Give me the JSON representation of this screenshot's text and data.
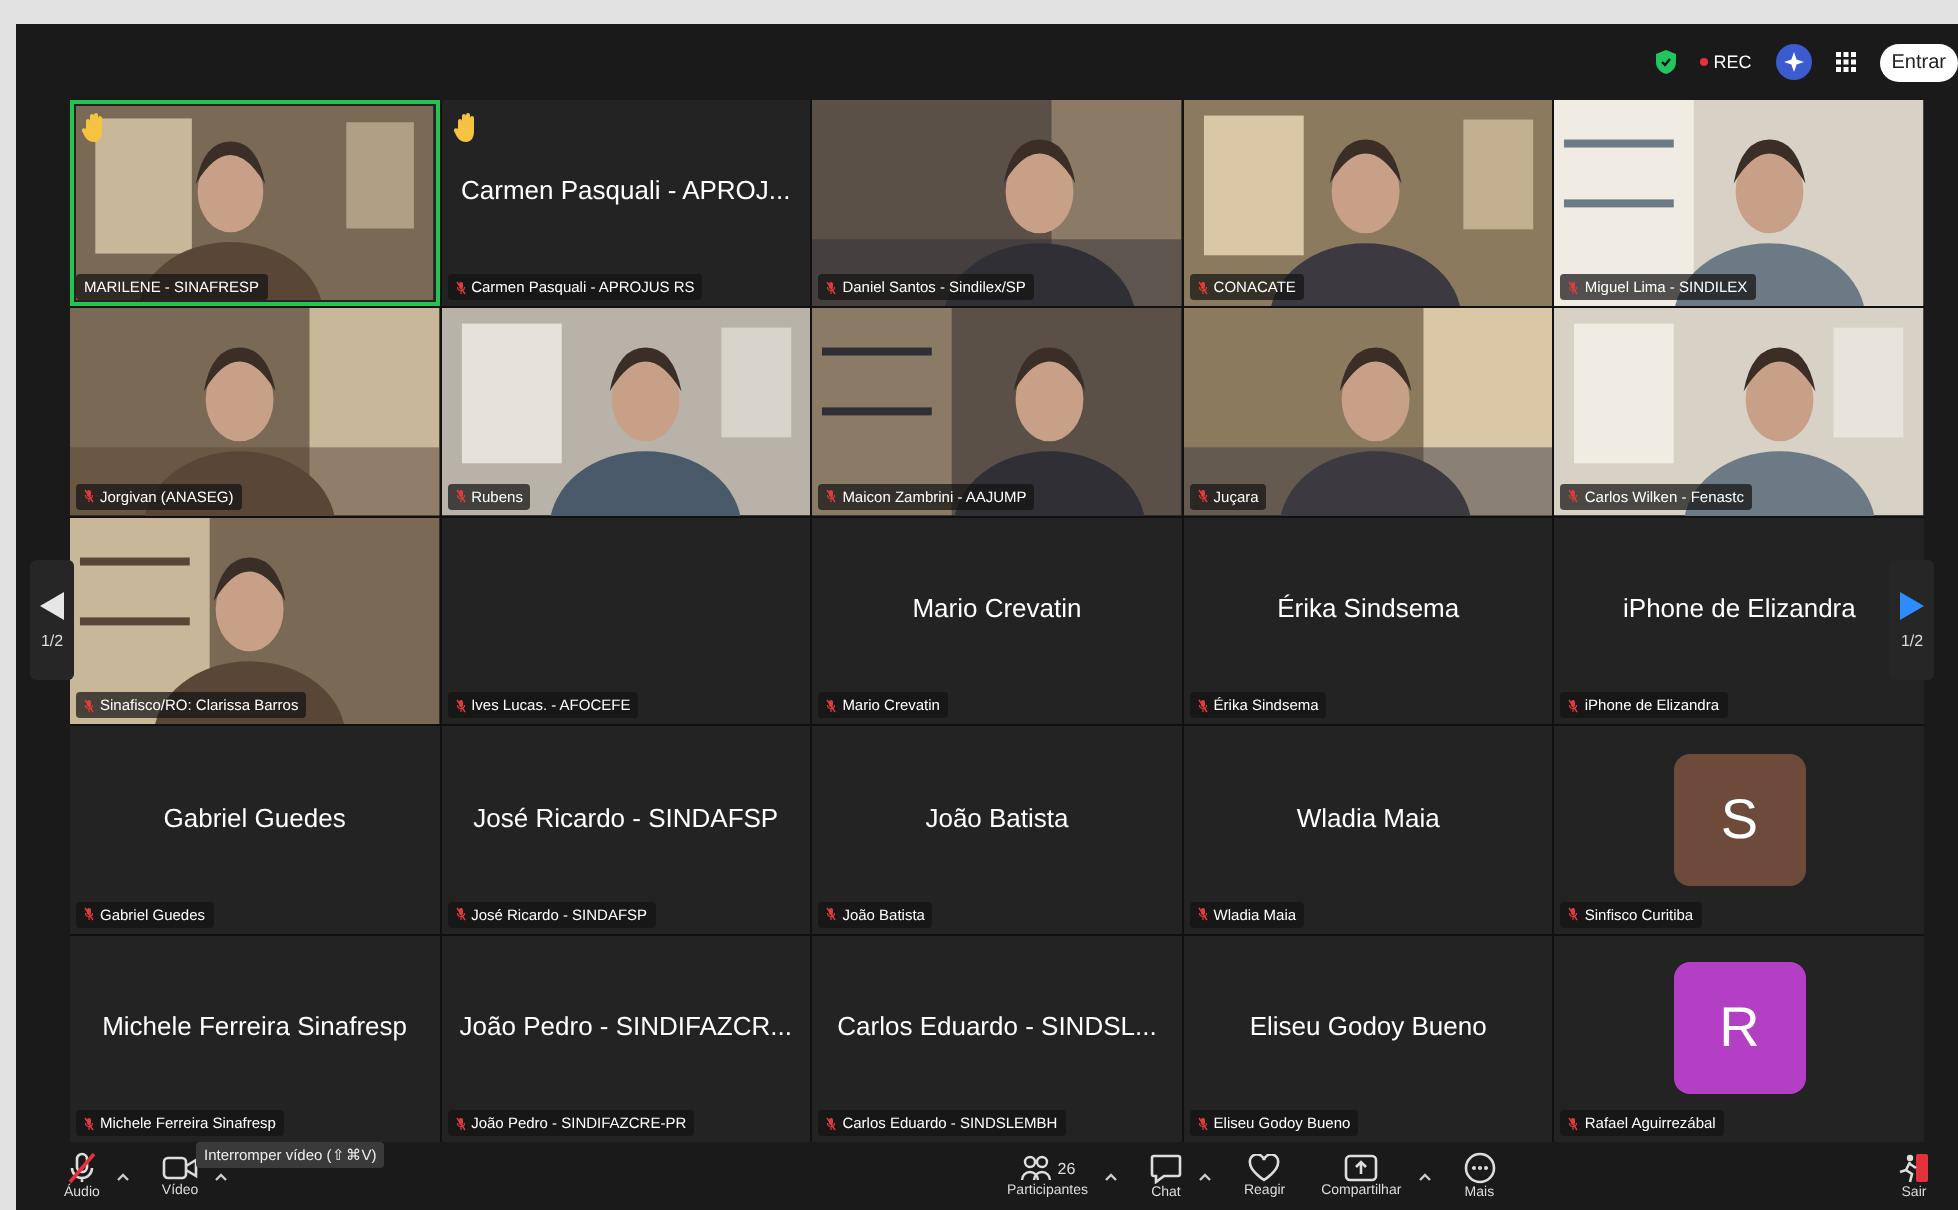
{
  "top_bar": {
    "recording_label": "REC",
    "join_button": "Entrar"
  },
  "pager": {
    "previous_label": "1/2",
    "next_label": "1/2"
  },
  "tiles": [
    {
      "kind": "video",
      "label": "MARILENE - SINAFRESP",
      "muted": false,
      "hand_raised": true,
      "active_speaker": true
    },
    {
      "kind": "name",
      "display_name": "Carmen Pasquali - APROJ...",
      "label": "Carmen Pasquali - APROJUS RS",
      "muted": true,
      "hand_raised": true,
      "active_speaker": false
    },
    {
      "kind": "video",
      "label": "Daniel Santos - Sindilex/SP",
      "muted": true,
      "hand_raised": false,
      "active_speaker": false
    },
    {
      "kind": "video",
      "label": "CONACATE",
      "muted": true,
      "hand_raised": false,
      "active_speaker": false
    },
    {
      "kind": "video",
      "label": "Miguel Lima - SINDILEX",
      "muted": true,
      "hand_raised": false,
      "active_speaker": false
    },
    {
      "kind": "video",
      "label": "Jorgivan (ANASEG)",
      "muted": true,
      "hand_raised": false,
      "active_speaker": false
    },
    {
      "kind": "video",
      "label": "Rubens",
      "muted": true,
      "hand_raised": false,
      "active_speaker": false
    },
    {
      "kind": "video",
      "label": "Maicon Zambrini - AAJUMP",
      "muted": true,
      "hand_raised": false,
      "active_speaker": false
    },
    {
      "kind": "video",
      "label": "Juçara",
      "muted": true,
      "hand_raised": false,
      "active_speaker": false
    },
    {
      "kind": "video",
      "label": "Carlos Wilken - Fenastc",
      "muted": true,
      "hand_raised": false,
      "active_speaker": false
    },
    {
      "kind": "video",
      "label": "Sinafisco/RO: Clarissa Barros",
      "muted": true,
      "hand_raised": false,
      "active_speaker": false
    },
    {
      "kind": "blank",
      "label": "Ives Lucas. - AFOCEFE",
      "muted": true,
      "hand_raised": false,
      "active_speaker": false
    },
    {
      "kind": "name",
      "display_name": "Mario Crevatin",
      "label": "Mario Crevatin",
      "muted": true,
      "hand_raised": false,
      "active_speaker": false
    },
    {
      "kind": "name",
      "display_name": "Érika Sindsema",
      "label": "Érika Sindsema",
      "muted": true,
      "hand_raised": false,
      "active_speaker": false
    },
    {
      "kind": "name",
      "display_name": "iPhone de Elizandra",
      "label": "iPhone de Elizandra",
      "muted": true,
      "hand_raised": false,
      "active_speaker": false
    },
    {
      "kind": "name",
      "display_name": "Gabriel Guedes",
      "label": "Gabriel Guedes",
      "muted": true,
      "hand_raised": false,
      "active_speaker": false
    },
    {
      "kind": "name",
      "display_name": "José Ricardo - SINDAFSP",
      "label": "José Ricardo - SINDAFSP",
      "muted": true,
      "hand_raised": false,
      "active_speaker": false
    },
    {
      "kind": "name",
      "display_name": "João Batista",
      "label": "João Batista",
      "muted": true,
      "hand_raised": false,
      "active_speaker": false
    },
    {
      "kind": "name",
      "display_name": "Wladia Maia",
      "label": "Wladia Maia",
      "muted": true,
      "hand_raised": false,
      "active_speaker": false
    },
    {
      "kind": "avatar",
      "initial": "S",
      "color": "#6e4a3b",
      "label": "Sinfisco Curitiba",
      "muted": true,
      "hand_raised": false,
      "active_speaker": false
    },
    {
      "kind": "name",
      "display_name": "Michele Ferreira Sinafresp",
      "label": "Michele Ferreira Sinafresp",
      "muted": true,
      "hand_raised": false,
      "active_speaker": false
    },
    {
      "kind": "name",
      "display_name": "João Pedro - SINDIFAZCR...",
      "label": "João Pedro - SINDIFAZCRE-PR",
      "muted": true,
      "hand_raised": false,
      "active_speaker": false
    },
    {
      "kind": "name",
      "display_name": "Carlos Eduardo - SINDSL...",
      "label": "Carlos Eduardo - SINDSLEMBH",
      "muted": true,
      "hand_raised": false,
      "active_speaker": false
    },
    {
      "kind": "name",
      "display_name": "Eliseu Godoy Bueno",
      "label": "Eliseu Godoy Bueno",
      "muted": true,
      "hand_raised": false,
      "active_speaker": false
    },
    {
      "kind": "avatar",
      "initial": "R",
      "color": "#b23fc4",
      "label": "Rafael Aguirrezábal",
      "muted": true,
      "hand_raised": false,
      "active_speaker": false
    }
  ],
  "tooltip": "Interromper vídeo (⇧⌘V)",
  "toolbar": [
    {
      "kind": "audio",
      "label": "Áudio",
      "muted": true,
      "has_menu": true
    },
    {
      "kind": "video",
      "label": "Vídeo",
      "has_menu": true
    },
    {
      "kind": "participants",
      "label": "Participantes",
      "count": "26",
      "has_menu": true
    },
    {
      "kind": "chat",
      "label": "Chat",
      "has_menu": true
    },
    {
      "kind": "react",
      "label": "Reagir",
      "has_menu": false
    },
    {
      "kind": "share",
      "label": "Compartilhar",
      "has_menu": true
    },
    {
      "kind": "more",
      "label": "Mais",
      "has_menu": false
    },
    {
      "kind": "leave",
      "label": "Sair",
      "has_menu": false
    }
  ]
}
